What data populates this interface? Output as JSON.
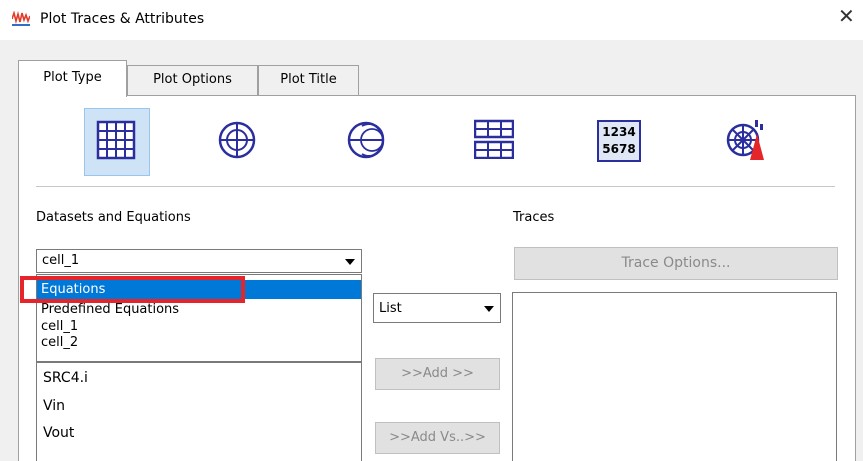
{
  "window": {
    "title": "Plot Traces & Attributes",
    "close_glyph": "✕"
  },
  "tabs": [
    {
      "label": "Plot Type",
      "active": true
    },
    {
      "label": "Plot Options",
      "active": false
    },
    {
      "label": "Plot Title",
      "active": false
    }
  ],
  "plot_types": [
    {
      "icon": "rectangular-grid-icon",
      "selected": true
    },
    {
      "icon": "polar-plot-icon",
      "selected": false
    },
    {
      "icon": "smith-chart-icon",
      "selected": false
    },
    {
      "icon": "tabular-grid-icon",
      "selected": false
    },
    {
      "icon": "numeric-display-icon",
      "text_top": "1234",
      "text_bottom": "5678",
      "selected": false
    },
    {
      "icon": "antenna-plot-icon",
      "selected": false
    }
  ],
  "datasets": {
    "label": "Datasets and Equations",
    "selected": "cell_1",
    "dropdown_items": [
      "Equations",
      "Predefined Equations",
      "cell_1",
      "cell_2"
    ],
    "highlighted_item": "Equations",
    "list_items": [
      "SRC4.i",
      "Vin",
      "Vout"
    ]
  },
  "middle": {
    "mode_select": "List",
    "add_button": ">>Add >>",
    "add_vs_button": ">>Add Vs..>>"
  },
  "traces": {
    "label": "Traces",
    "options_button": "Trace Options..."
  },
  "colors": {
    "selection_blue": "#0078d7",
    "annotation_red": "#e5252a",
    "icon_blue": "#2b2f9e"
  }
}
